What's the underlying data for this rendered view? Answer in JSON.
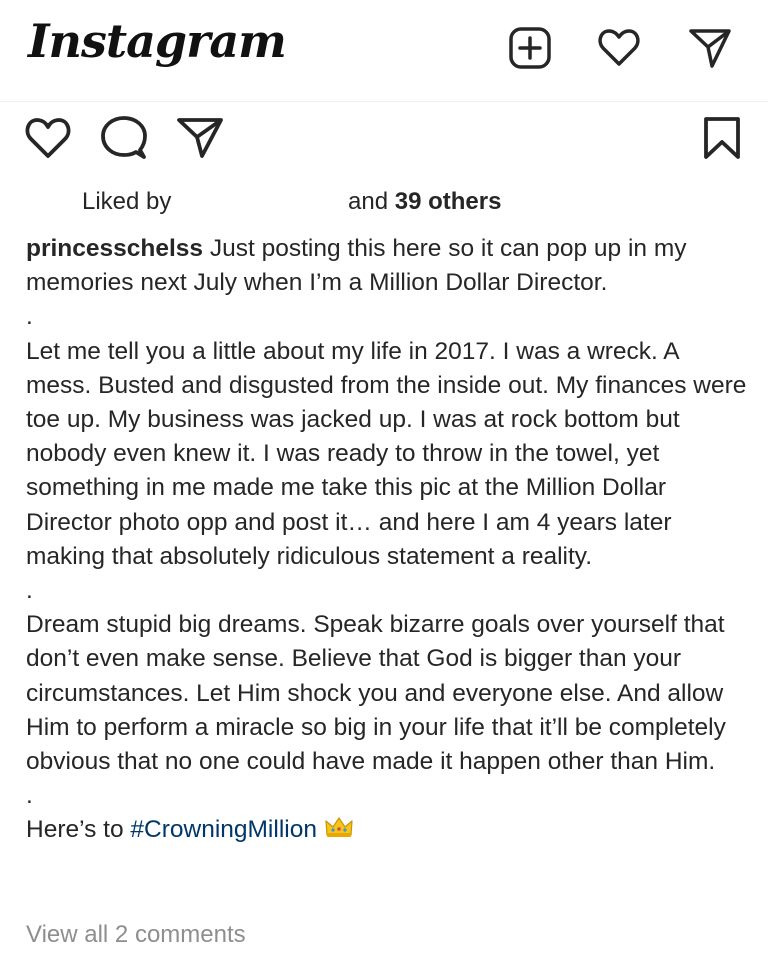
{
  "header": {
    "logo_text": "Instagram",
    "icons": [
      "add-post-icon",
      "heart-icon",
      "direct-message-icon"
    ]
  },
  "post_actions": {
    "icons": [
      "like-icon",
      "comment-icon",
      "share-icon",
      "save-bookmark-icon"
    ]
  },
  "likes": {
    "prefix": "Liked by",
    "and_text": "and",
    "others": "39 others"
  },
  "caption": {
    "username": "princesschelss",
    "intro": "Just posting this here so it can pop up in my memories next July when I’m a Million Dollar Director.",
    "separator": ".",
    "paragraph1": "Let me tell you a little about my life in 2017. I was a wreck. A mess. Busted and disgusted from the inside out. My finances were toe up. My business was jacked up. I was at rock bottom but nobody even knew it. I was ready to throw in the towel, yet something in me made me take this pic at the Million Dollar Director photo opp and post it… and here I am 4 years later making that absolutely ridiculous statement a reality.",
    "paragraph2": "Dream stupid big dreams. Speak bizarre goals over yourself that don’t even make sense. Believe that God is bigger than your circumstances. Let Him shock you and everyone else. And allow Him to perform a miracle so big in your life that it’ll be completely obvious that no one could have made it happen other than Him.",
    "closing": "Here’s to",
    "hashtag": "#CrowningMillion",
    "emoji": "crown-emoji"
  },
  "comments": {
    "view_all": "View all 2 comments"
  },
  "colors": {
    "text": "#262626",
    "hashtag": "#00376b",
    "muted": "#8e8e8e",
    "crown": "#f5c518"
  }
}
